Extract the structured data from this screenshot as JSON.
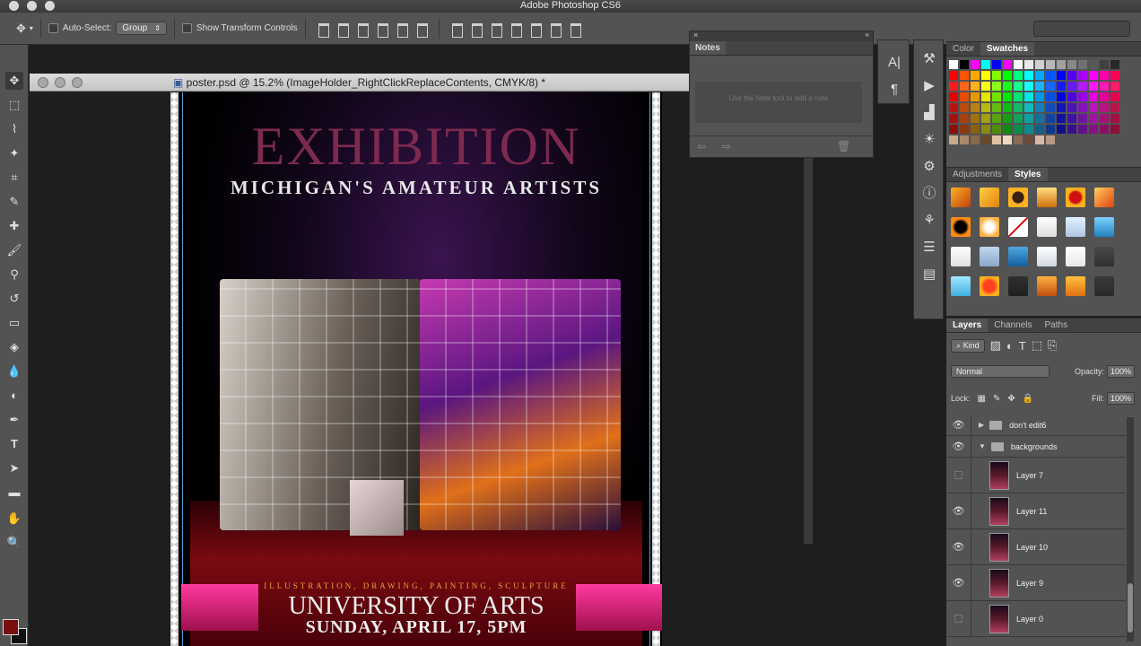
{
  "app": {
    "title": "Adobe Photoshop CS6"
  },
  "options": {
    "auto_select_label": "Auto-Select:",
    "auto_select_value": "Group",
    "show_transform_label": "Show Transform Controls"
  },
  "document": {
    "tab_title": "poster.psd @ 15.2% (ImageHolder_RightClickReplaceContents, CMYK/8) *",
    "poster": {
      "title": "EXHIBITION",
      "subtitle": "MICHIGAN'S AMATEUR ARTISTS",
      "caption": "ILLUSTRATION, DRAWING, PAINTING, SCULPTURE",
      "university": "UNIVERSITY OF ARTS",
      "date": "SUNDAY, APRIL 17, 5PM"
    }
  },
  "notes_panel": {
    "tab": "Notes",
    "placeholder": "Use the Note tool to add a note"
  },
  "color_panel": {
    "tabs": [
      "Color",
      "Swatches"
    ],
    "active": "Swatches"
  },
  "styles_panel": {
    "tabs": [
      "Adjustments",
      "Styles"
    ],
    "active": "Styles"
  },
  "layers_panel": {
    "tabs": [
      "Layers",
      "Channels",
      "Paths"
    ],
    "active": "Layers",
    "filter_label": "Kind",
    "blend_mode": "Normal",
    "opacity_label": "Opacity:",
    "opacity_value": "100%",
    "lock_label": "Lock:",
    "fill_label": "Fill:",
    "fill_value": "100%",
    "layers": [
      {
        "name": "don't edit6",
        "type": "group",
        "visible": true,
        "expanded": false
      },
      {
        "name": "backgrounds",
        "type": "group",
        "visible": true,
        "expanded": true
      },
      {
        "name": "Layer 7",
        "type": "layer",
        "visible": false
      },
      {
        "name": "Layer 11",
        "type": "layer",
        "visible": true
      },
      {
        "name": "Layer 10",
        "type": "layer",
        "visible": true
      },
      {
        "name": "Layer 9",
        "type": "layer",
        "visible": true
      },
      {
        "name": "Layer 0",
        "type": "layer",
        "visible": false
      }
    ]
  },
  "colors": {
    "foreground": "#7a0f0f",
    "background": "#111111",
    "poster_title": "#7c2a4e",
    "accent_band": "#e0187a"
  }
}
